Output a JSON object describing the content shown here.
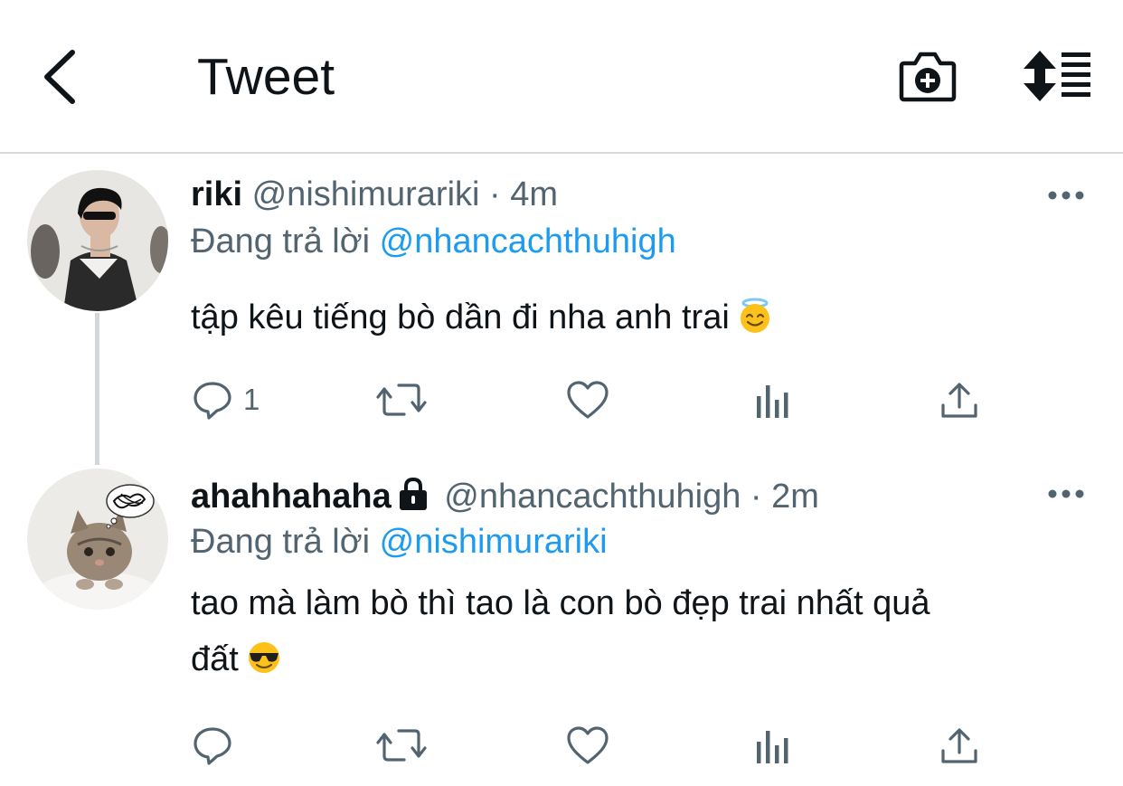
{
  "header": {
    "title": "Tweet",
    "back_icon": "chevron-left-icon",
    "camera_icon": "camera-plus-icon",
    "sort_icon": "sort-replies-icon"
  },
  "tweets": [
    {
      "name": "riki",
      "handle": "@nishimurariki",
      "separator": "·",
      "time": "4m",
      "replying_prefix": "Đang trả lời",
      "replying_to": "@nhancachthuhigh",
      "text": "tập kêu tiếng bò dần đi nha anh trai",
      "emoji": "smiling-face-with-halo",
      "reply_count": "1",
      "protected": false
    },
    {
      "name": "ahahhahaha",
      "handle": "@nhancachthuhigh",
      "separator": "·",
      "time": "2m",
      "replying_prefix": "Đang trả lời",
      "replying_to": "@nishimurariki",
      "text_line1": "tao mà làm bò thì tao là con bò đẹp trai nhất quả",
      "text_line2": "đất",
      "emoji": "smiling-face-with-sunglasses",
      "reply_count": "",
      "protected": true
    }
  ],
  "colors": {
    "link": "#1d9bf0",
    "secondary": "#536471",
    "text": "#0f1419",
    "divider": "#d9d9d9"
  }
}
